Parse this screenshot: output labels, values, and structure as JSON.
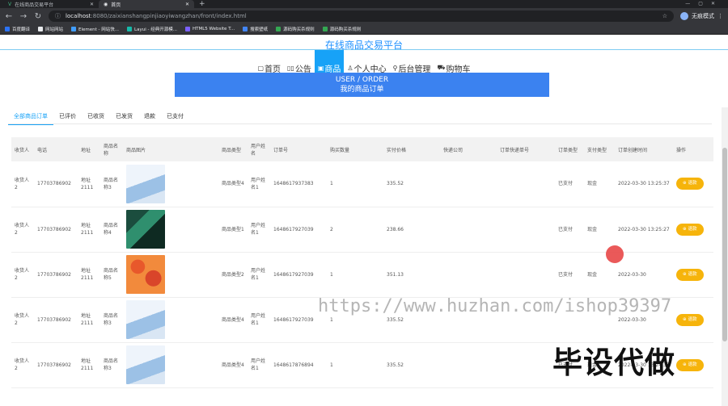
{
  "browser": {
    "tabs": [
      {
        "label": "在线商品交易平台",
        "active": false
      },
      {
        "label": "首页",
        "active": true
      }
    ],
    "url_host": "localhost",
    "url_path": ":8080/zaixianshangpinjiaoyiwangzhan/front/index.html",
    "profile": "无痕模式",
    "bookmarks": [
      "百度翻译",
      "网站网站",
      "Element - 网站快...",
      "Layui - 经典开源模...",
      "HTML5 Website T...",
      "搜索壁纸",
      "源码购买杀规则",
      "源码购买杀规则"
    ]
  },
  "site": {
    "title": "在线商品交易平台",
    "nav": [
      {
        "icon": "▢",
        "label": "首页",
        "active": false
      },
      {
        "icon": "▯▯",
        "label": "公告",
        "active": false
      },
      {
        "icon": "▣",
        "label": "商品",
        "active": true
      },
      {
        "icon": "♙",
        "label": "个人中心",
        "active": false
      },
      {
        "icon": "⚲",
        "label": "后台管理",
        "active": false
      },
      {
        "icon": "⛟",
        "label": "购物车",
        "active": false
      }
    ],
    "banner": {
      "line1": "USER / ORDER",
      "line2": "我的商品订单"
    }
  },
  "subtabs": [
    "全部商品订单",
    "已评价",
    "已收货",
    "已发货",
    "退款",
    "已支付"
  ],
  "table": {
    "headers": [
      "收货人",
      "电话",
      "地址",
      "商品名称",
      "商品图片",
      "商品类型",
      "用户姓名",
      "订单号",
      "购买数量",
      "实付价格",
      "快递公司",
      "订单快递单号",
      "订单类型",
      "支付类型",
      "订单创建时间",
      "操作"
    ],
    "rows": [
      {
        "name": "收货人2",
        "phone": "17703786902",
        "addr": "地址2111",
        "product": "商品名称3",
        "thumb": "dress",
        "type": "商品类型4",
        "user": "用户姓名1",
        "order": "1648617937383",
        "qty": "1",
        "price": "335.52",
        "courier": "",
        "tracking": "",
        "status": "已支付",
        "pay": "现金",
        "time": "2022-03-30 13:25:37",
        "action": "退款"
      },
      {
        "name": "收货人2",
        "phone": "17703786902",
        "addr": "地址2111",
        "product": "商品名称4",
        "thumb": "green",
        "type": "商品类型1",
        "user": "用户姓名1",
        "order": "1648617927039",
        "qty": "2",
        "price": "238.66",
        "courier": "",
        "tracking": "",
        "status": "已支付",
        "pay": "现金",
        "time": "2022-03-30 13:25:27",
        "action": "退款"
      },
      {
        "name": "收货人2",
        "phone": "17703786902",
        "addr": "地址2111",
        "product": "商品名称5",
        "thumb": "red",
        "type": "商品类型2",
        "user": "用户姓名1",
        "order": "1648617927039",
        "qty": "1",
        "price": "351.13",
        "courier": "",
        "tracking": "",
        "status": "已支付",
        "pay": "现金",
        "time": "2022-03-30",
        "action": "退款"
      },
      {
        "name": "收货人2",
        "phone": "17703786902",
        "addr": "地址2111",
        "product": "商品名称3",
        "thumb": "dress",
        "type": "商品类型4",
        "user": "用户姓名1",
        "order": "1648617927039",
        "qty": "1",
        "price": "335.52",
        "courier": "",
        "tracking": "",
        "status": "",
        "pay": "",
        "time": "2022-03-30",
        "action": "退款"
      },
      {
        "name": "收货人2",
        "phone": "17703786902",
        "addr": "地址2111",
        "product": "商品名称3",
        "thumb": "dress",
        "type": "商品类型4",
        "user": "用户姓名1",
        "order": "1648617876894",
        "qty": "1",
        "price": "335.52",
        "courier": "",
        "tracking": "",
        "status": "已支付",
        "pay": "现金",
        "time": "2022-03-30 13:24:37",
        "action": "退款"
      }
    ]
  },
  "overlay": {
    "watermark": "https://www.huzhan.com/ishop39397",
    "big_text": "毕设代做"
  },
  "colors": {
    "accent": "#17a2f7",
    "banner": "#3b82f0",
    "refund": "#f6b40b"
  }
}
